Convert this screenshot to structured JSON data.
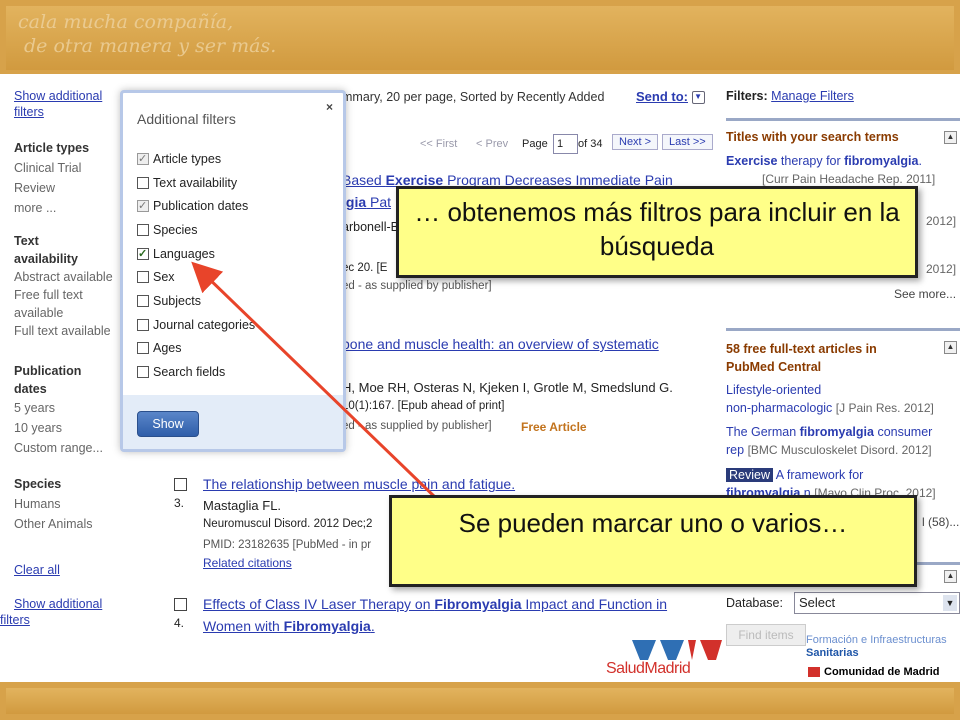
{
  "banner": {
    "script_line1": "cala mucha compañía,",
    "script_line2": "de otra manera y ser más."
  },
  "sidebar": {
    "show_additional": "Show additional filters",
    "article_types": {
      "heading": "Article types",
      "items": [
        "Clinical Trial",
        "Review",
        "more ..."
      ]
    },
    "text_availability": {
      "heading": "Text availability",
      "items": [
        "Abstract available",
        "Free full text available",
        "Full text available"
      ]
    },
    "publication_dates": {
      "heading": "Publication dates",
      "items": [
        "5 years",
        "10 years",
        "Custom range..."
      ]
    },
    "species": {
      "heading": "Species",
      "items": [
        "Humans",
        "Other Animals"
      ]
    },
    "clear_all": "Clear all",
    "show_additional_bottom": "Show additional filters"
  },
  "results_header": {
    "display_settings": "mmary, 20 per page, Sorted by Recently Added",
    "send_to": "Send to:",
    "first": "<< First",
    "prev": "< Prev",
    "page_label": "Page",
    "page_value": "1",
    "of_pages": "of 34",
    "next": "Next >",
    "last": "Last >>"
  },
  "results": [
    {
      "title_fragment1": "Based ",
      "title_bold": "Exercise",
      "title_fragment2": " Program Decreases Immediate Pain",
      "title_line2a": "lgia",
      "title_line2b": " Pat",
      "authors": "arbonell-B",
      "source": "ec 20. [E",
      "status": "ed - as supplied by publisher]"
    },
    {
      "title_fragment": " bone and muscle health: an overview of systematic",
      "authors": "H, Moe RH, Osteras N, Kjeken I, Grotle M, Smedslund G.",
      "source": "10(1):167. [Epub ahead of print]",
      "status": "ed - as supplied by publisher]",
      "free": "Free Article"
    },
    {
      "number": "3.",
      "title": "The relationship between muscle pain and fatigue.",
      "authors": "Mastaglia FL.",
      "source": "Neuromuscul Disord. 2012 Dec;2",
      "pmid": "PMID: 23182635 [PubMed - in pr",
      "related": "Related citations"
    },
    {
      "number": "4.",
      "title_a": "Effects of Class IV Laser Therapy on ",
      "title_b": "Fibromyalgia",
      "title_c": " Impact and Function in",
      "title_d": "Women with ",
      "title_e": "Fibromyalgia",
      "title_f": "."
    }
  ],
  "right": {
    "filters_label": "Filters:",
    "manage_filters": "Manage Filters",
    "titles_heading": "Titles with your search terms",
    "titles_item1_a": "Exercise",
    "titles_item1_b": " therapy for ",
    "titles_item1_c": "fibromyalgia",
    "titles_item1_d": ".",
    "titles_item1_src": "[Curr Pain Headache Rep. 2011]",
    "titles_item2_tail": "2012]",
    "titles_item3_tail": "2012]",
    "see_more": "See more...",
    "free_heading": "58 free full-text articles in PubMed Central",
    "free_item1_a": "Lifestyle-oriented",
    "free_item1_b": "non-pharmacologic",
    "free_item1_src": "[J Pain Res. 2012]",
    "free_item2_a": "The German ",
    "free_item2_b": "fibromyalgia",
    "free_item2_c": " consumer",
    "free_item2_d": "rep",
    "free_item2_src": "[BMC Musculoskelet Disord. 2012]",
    "free_item3_badge": "Review",
    "free_item3_a": " A framework for",
    "free_item3_b": "fibromyalgia",
    "free_item3_c": " n",
    "free_item3_src": "[Mayo Clin Proc. 2012]",
    "free_more": "l (58)...",
    "database_label": "Database:",
    "database_value": "Select",
    "find_items": "Find items"
  },
  "popup": {
    "title": "Additional filters",
    "close": "×",
    "filters": [
      {
        "label": "Article types",
        "state": "checked-disabled"
      },
      {
        "label": "Text availability",
        "state": "unchecked"
      },
      {
        "label": "Publication dates",
        "state": "checked-disabled"
      },
      {
        "label": "Species",
        "state": "unchecked"
      },
      {
        "label": "Languages",
        "state": "checked"
      },
      {
        "label": "Sex",
        "state": "unchecked"
      },
      {
        "label": "Subjects",
        "state": "unchecked"
      },
      {
        "label": "Journal categories",
        "state": "unchecked"
      },
      {
        "label": "Ages",
        "state": "unchecked"
      },
      {
        "label": "Search fields",
        "state": "unchecked"
      }
    ],
    "show_button": "Show"
  },
  "callouts": {
    "top": "… obtenemos más filtros para incluir en la búsqueda",
    "bottom": "Se pueden marcar uno o varios…"
  },
  "logos": {
    "salud": "SaludMadrid",
    "sanitarias_line1": "Formación e Infraestructuras",
    "sanitarias_line2": "Sanitarias",
    "comunidad": "Comunidad de Madrid"
  },
  "colors": {
    "banner": "#d7a24a",
    "link": "#2a3bb0",
    "callout_bg": "#ffff88",
    "arrow": "#e8442a",
    "heading_right": "#8a3b00"
  }
}
